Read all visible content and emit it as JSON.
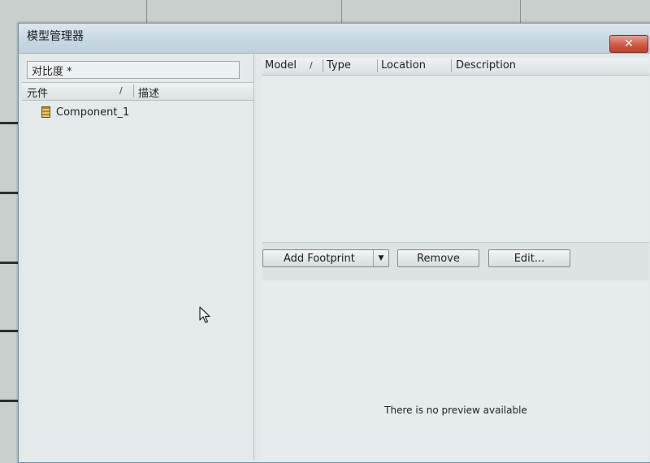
{
  "dialog": {
    "title": "模型管理器",
    "close_glyph": "✕"
  },
  "left_panel": {
    "filter_value": "对比度 *",
    "columns": [
      "元件",
      "描述"
    ],
    "sort_glyph": "/",
    "items": [
      {
        "name": "Component_1",
        "icon": "component-icon"
      }
    ]
  },
  "right_panel": {
    "columns": [
      "Model",
      "Type",
      "Location",
      "Description"
    ],
    "sort_glyph": "/",
    "buttons": {
      "add_footprint": "Add Footprint",
      "remove": "Remove",
      "edit": "Edit..."
    },
    "dropdown_glyph": "▼",
    "preview_text": "There is no preview available"
  },
  "colors": {
    "close_button": "#c94a36",
    "titlebar": "#c8d8e3"
  }
}
